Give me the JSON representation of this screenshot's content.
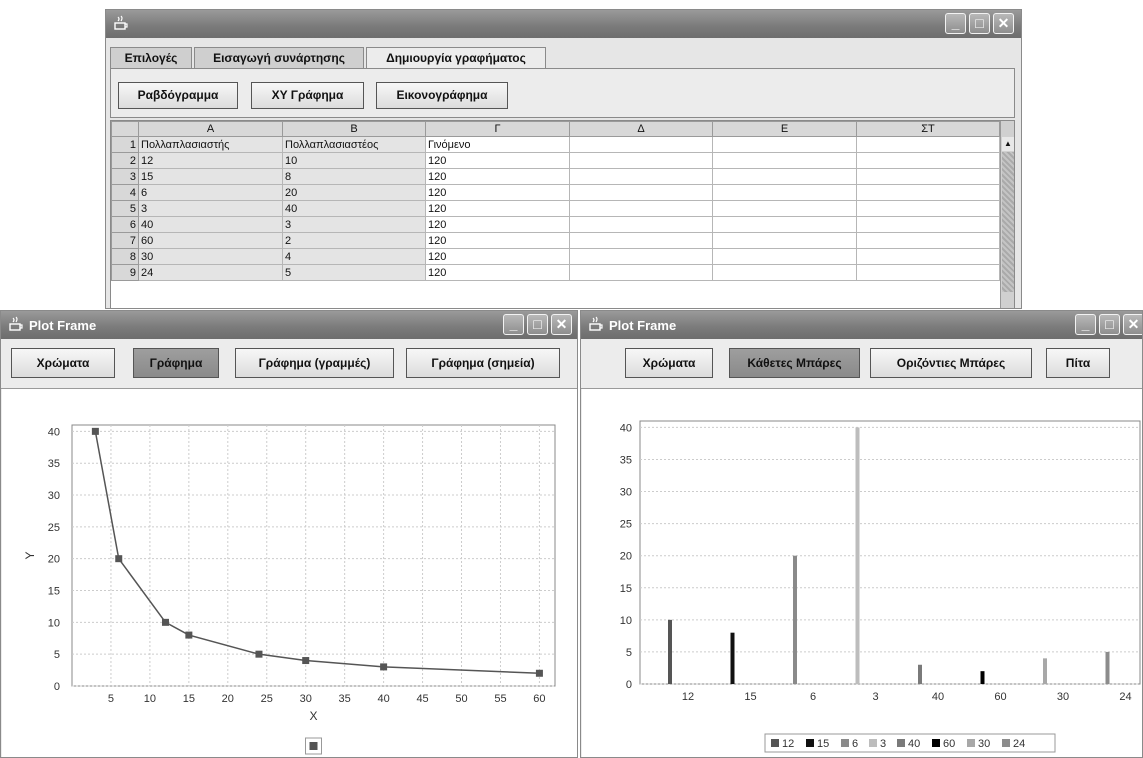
{
  "main_window": {
    "tabs": [
      "Επιλογές",
      "Εισαγωγή συνάρτησης",
      "Δημιουργία γραφήματος"
    ],
    "buttons": [
      "Ραβδόγραμμα",
      "XY Γράφημα",
      "Εικονογράφημα"
    ],
    "columns": [
      "A",
      "B",
      "Γ",
      "Δ",
      "E",
      "ΣΤ"
    ],
    "rows": [
      {
        "n": "1",
        "a": "Πολλαπλασιαστής",
        "b": "Πολλαπλασιαστέος",
        "c": "Γινόμενο"
      },
      {
        "n": "2",
        "a": "12",
        "b": "10",
        "c": "120"
      },
      {
        "n": "3",
        "a": "15",
        "b": "8",
        "c": "120"
      },
      {
        "n": "4",
        "a": "6",
        "b": "20",
        "c": "120"
      },
      {
        "n": "5",
        "a": "3",
        "b": "40",
        "c": "120"
      },
      {
        "n": "6",
        "a": "40",
        "b": "3",
        "c": "120"
      },
      {
        "n": "7",
        "a": "60",
        "b": "2",
        "c": "120"
      },
      {
        "n": "8",
        "a": "30",
        "b": "4",
        "c": "120"
      },
      {
        "n": "9",
        "a": "24",
        "b": "5",
        "c": "120"
      }
    ],
    "window_buttons": {
      "minimize": "_",
      "maximize": "□",
      "close": "✕"
    }
  },
  "plot_left": {
    "title": "Plot Frame",
    "buttons": [
      "Χρώματα",
      "Γράφημα",
      "Γράφημα (γραμμές)",
      "Γράφημα (σημεία)"
    ],
    "active_button": 1
  },
  "plot_right": {
    "title": "Plot Frame",
    "buttons": [
      "Χρώματα",
      "Κάθετες Μπάρες",
      "Οριζόντιες Μπάρες",
      "Πίτα"
    ],
    "active_button": 1
  },
  "chart_data": [
    {
      "type": "line",
      "xlabel": "X",
      "ylabel": "Y",
      "x": [
        3,
        6,
        12,
        15,
        24,
        30,
        40,
        60
      ],
      "y": [
        40,
        20,
        10,
        8,
        5,
        4,
        3,
        2
      ],
      "xticks": [
        5,
        10,
        15,
        20,
        25,
        30,
        35,
        40,
        45,
        50,
        55,
        60
      ],
      "yticks": [
        0,
        5,
        10,
        15,
        20,
        25,
        30,
        35,
        40
      ],
      "grid": true,
      "color": "#555555"
    },
    {
      "type": "bar",
      "categories": [
        "12",
        "15",
        "6",
        "3",
        "40",
        "60",
        "30",
        "24"
      ],
      "values": [
        10,
        8,
        20,
        40,
        3,
        2,
        4,
        5
      ],
      "colors": [
        "#555555",
        "#111111",
        "#8a8a8a",
        "#bdbdbd",
        "#7a7a7a",
        "#000000",
        "#a8a8a8",
        "#8c8c8c"
      ],
      "legend": [
        "12",
        "15",
        "6",
        "3",
        "40",
        "60",
        "30",
        "24"
      ],
      "yticks": [
        0,
        5,
        10,
        15,
        20,
        25,
        30,
        35,
        40
      ],
      "grid": true,
      "legend_position": "bottom"
    }
  ]
}
